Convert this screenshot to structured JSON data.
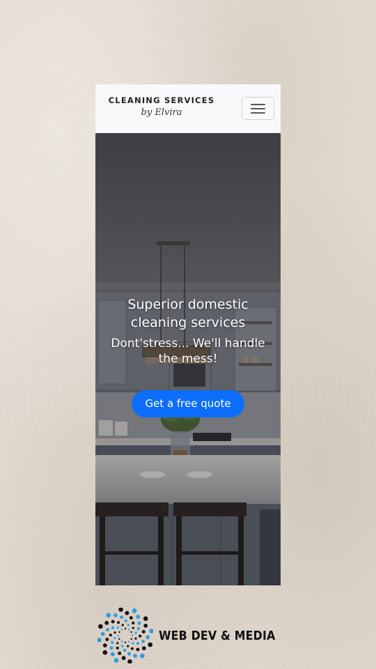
{
  "navbar": {
    "brand_title": "CLEANING SERVICES",
    "brand_subtitle": "by Elvira",
    "menu_icon": "hamburger-icon"
  },
  "hero": {
    "title": "Superior domestic cleaning services",
    "tagline": "Dont'stress... We'll handle the mess!",
    "cta_label": "Get a free quote"
  },
  "footer": {
    "logo_text": "WEB DEV & MEDIA",
    "logo_icon": "dotted-spiral-icon"
  },
  "colors": {
    "cta": "#0d6efd",
    "navbar_bg": "#f8f9fa",
    "page_bg": "#e4dbd1",
    "logo_dot_blue": "#2a9fe0",
    "logo_dot_dark": "#111111"
  }
}
